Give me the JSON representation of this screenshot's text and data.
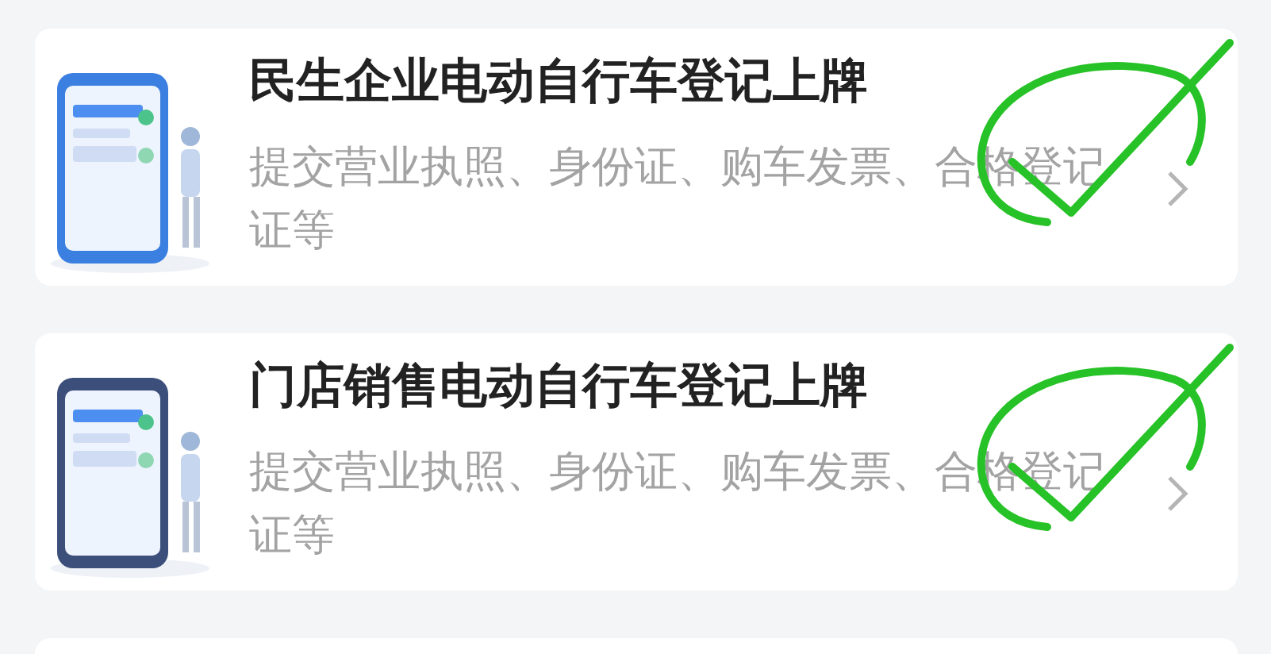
{
  "cards": [
    {
      "title": "民生企业电动自行车登记上牌",
      "description": "提交营业执照、身份证、购车发票、合格登记证等",
      "marked": true
    },
    {
      "title": "门店销售电动自行车登记上牌",
      "description": "提交营业执照、身份证、购车发票、合格登记证等",
      "marked": true
    }
  ]
}
